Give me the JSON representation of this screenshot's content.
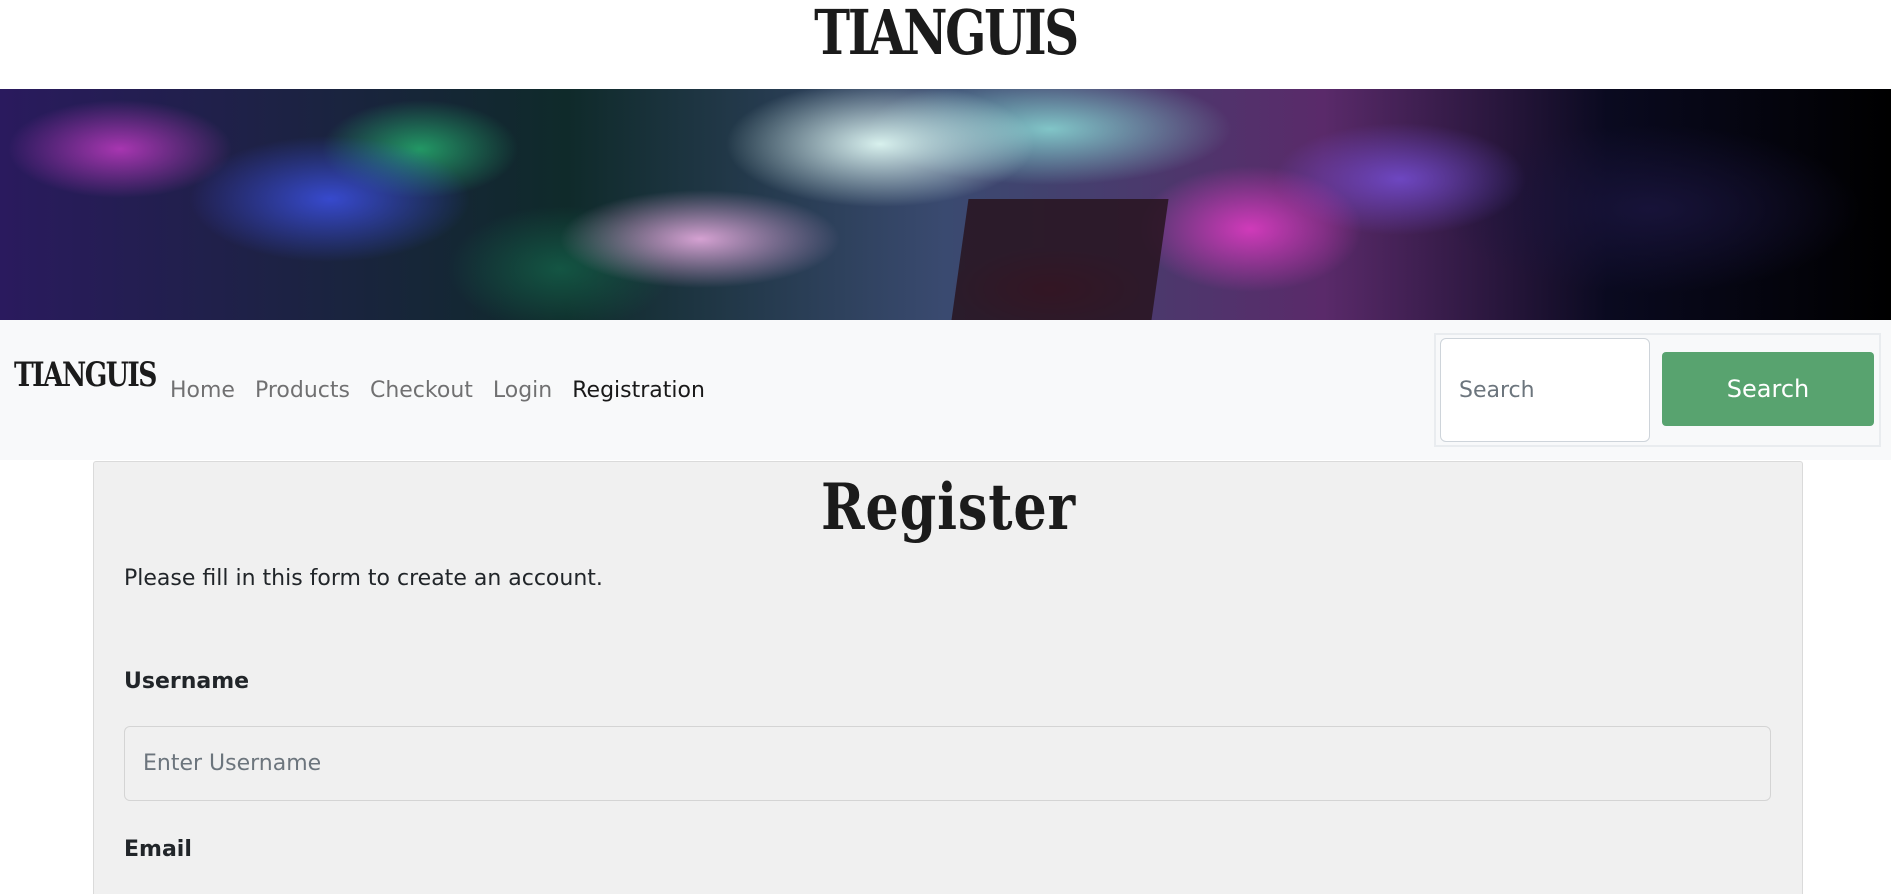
{
  "site": {
    "logo_text": "TIANGUIS"
  },
  "navbar": {
    "brand": "TIANGUIS",
    "links": [
      {
        "label": "Home"
      },
      {
        "label": "Products"
      },
      {
        "label": "Checkout"
      },
      {
        "label": "Login"
      },
      {
        "label": "Registration",
        "active": true
      }
    ],
    "search": {
      "placeholder": "Search",
      "value": "",
      "button_label": "Search"
    }
  },
  "form": {
    "title": "Register",
    "subtitle": "Please fill in this form to create an account.",
    "fields": [
      {
        "label": "Username",
        "placeholder": "Enter Username",
        "value": ""
      },
      {
        "label": "Email"
      }
    ]
  },
  "colors": {
    "navbar_bg": "#f8f9fa",
    "search_button": "#58a36f",
    "card_bg": "#f0f0f0",
    "text": "#212529"
  }
}
